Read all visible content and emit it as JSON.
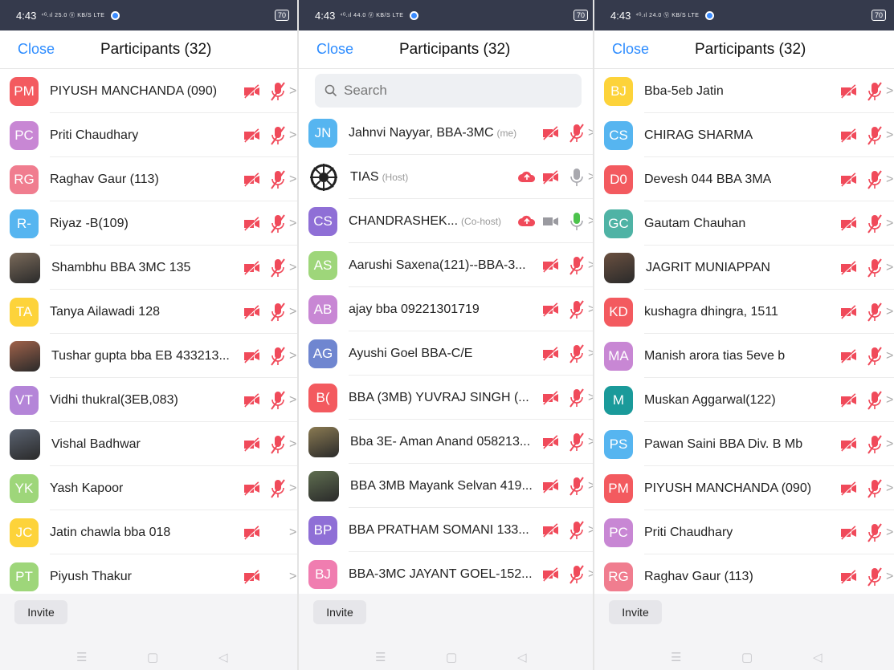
{
  "colors": {
    "accent": "#2d8cff",
    "muted_red": "#f04a5a",
    "statusbar": "#353a4c"
  },
  "panels": [
    {
      "status": {
        "time": "4:43",
        "signal": "⁴ᴳ.ıl 25.0 Ⓥ KB/S LTE",
        "battery": "70"
      },
      "header": {
        "close": "Close",
        "title": "Participants (32)"
      },
      "search": null,
      "participants": [
        {
          "initials": "PM",
          "color": "#f35a5f",
          "name": "PIYUSH MANCHANDA (090)",
          "video": "muted",
          "audio": "muted"
        },
        {
          "initials": "PC",
          "color": "#c887d4",
          "name": "Priti Chaudhary",
          "video": "muted",
          "audio": "muted"
        },
        {
          "initials": "RG",
          "color": "#f07d8f",
          "name": "Raghav Gaur (113)",
          "video": "muted",
          "audio": "muted"
        },
        {
          "initials": "R-",
          "color": "#56b5f0",
          "name": "Riyaz -B(109)",
          "video": "muted",
          "audio": "muted"
        },
        {
          "photo": "#7a6a5a",
          "name": "Shambhu BBA 3MC 135",
          "video": "muted",
          "audio": "muted"
        },
        {
          "initials": "TA",
          "color": "#fdd33a",
          "name": "Tanya Ailawadi 128",
          "video": "muted",
          "audio": "muted"
        },
        {
          "photo": "#a0624a",
          "name": "Tushar gupta bba EB 433213...",
          "video": "muted",
          "audio": "muted"
        },
        {
          "initials": "VT",
          "color": "#b485d8",
          "name": "Vidhi thukral(3EB,083)",
          "video": "muted",
          "audio": "muted"
        },
        {
          "photo": "#5a6270",
          "name": "Vishal Badhwar",
          "video": "muted",
          "audio": "muted"
        },
        {
          "initials": "YK",
          "color": "#9ed67a",
          "name": "Yash Kapoor",
          "video": "muted",
          "audio": "muted"
        },
        {
          "initials": "JC",
          "color": "#fdd33a",
          "name": "Jatin chawla bba 018",
          "video": "muted",
          "audio": "none"
        },
        {
          "initials": "PT",
          "color": "#9ed67a",
          "name": "Piyush Thakur",
          "video": "muted",
          "audio": "none"
        }
      ],
      "invite": "Invite"
    },
    {
      "status": {
        "time": "4:43",
        "signal": "⁴ᴳ.ıl 44.0 Ⓥ KB/S LTE",
        "battery": "70"
      },
      "header": {
        "close": "Close",
        "title": "Participants (32)"
      },
      "search": "Search",
      "participants": [
        {
          "initials": "JN",
          "color": "#56b5f0",
          "name": "Jahnvi Nayyar, BBA-3MC",
          "tag": "(me)",
          "video": "muted",
          "audio": "muted"
        },
        {
          "logo": true,
          "name": "TIAS",
          "tag": "(Host)",
          "cloud": true,
          "video": "muted",
          "audio": "off"
        },
        {
          "initials": "CS",
          "color": "#8f6fd6",
          "name": "CHANDRASHEK...",
          "tag": "(Co-host)",
          "cloud": true,
          "video": "grey",
          "audio": "on"
        },
        {
          "initials": "AS",
          "color": "#9ed67a",
          "name": "Aarushi Saxena(121)--BBA-3...",
          "video": "muted",
          "audio": "muted"
        },
        {
          "initials": "AB",
          "color": "#c887d4",
          "name": "ajay bba 09221301719",
          "video": "muted",
          "audio": "muted"
        },
        {
          "initials": "AG",
          "color": "#6f86d0",
          "name": "Ayushi Goel BBA-C/E",
          "video": "muted",
          "audio": "muted"
        },
        {
          "initials": "B(",
          "color": "#f35a5f",
          "name": "BBA (3MB) YUVRAJ SINGH  (...",
          "video": "muted",
          "audio": "muted"
        },
        {
          "photo": "#8a7a52",
          "name": "Bba 3E- Aman Anand 058213...",
          "video": "muted",
          "audio": "muted"
        },
        {
          "photo": "#5f6e50",
          "name": "BBA 3MB Mayank Selvan 419...",
          "video": "muted",
          "audio": "muted"
        },
        {
          "initials": "BP",
          "color": "#8f6fd6",
          "name": "BBA PRATHAM SOMANI 133...",
          "video": "muted",
          "audio": "muted"
        },
        {
          "initials": "BJ",
          "color": "#f07db0",
          "name": "BBA-3MC JAYANT GOEL-152...",
          "video": "muted",
          "audio": "muted"
        }
      ],
      "invite": "Invite"
    },
    {
      "status": {
        "time": "4:43",
        "signal": "⁴ᴳ.ıl 24.0 Ⓥ KB/S LTE",
        "battery": "70"
      },
      "header": {
        "close": "Close",
        "title": "Participants (32)"
      },
      "search": null,
      "participants": [
        {
          "initials": "BJ",
          "color": "#fdd33a",
          "name": "Bba-5eb Jatin",
          "video": "muted",
          "audio": "muted"
        },
        {
          "initials": "CS",
          "color": "#56b5f0",
          "name": "CHIRAG SHARMA",
          "video": "muted",
          "audio": "muted"
        },
        {
          "initials": "D0",
          "color": "#f35a5f",
          "name": "Devesh 044 BBA 3MA",
          "video": "muted",
          "audio": "muted"
        },
        {
          "initials": "GC",
          "color": "#4fb3a5",
          "name": "Gautam Chauhan",
          "video": "muted",
          "audio": "muted"
        },
        {
          "photo": "#6a5040",
          "name": "JAGRIT MUNIAPPAN",
          "video": "muted",
          "audio": "muted"
        },
        {
          "initials": "KD",
          "color": "#f35a5f",
          "name": "kushagra dhingra, 1511",
          "video": "muted",
          "audio": "muted"
        },
        {
          "initials": "MA",
          "color": "#c887d4",
          "name": "Manish arora  tias 5eve b",
          "video": "muted",
          "audio": "muted"
        },
        {
          "initials": "M",
          "color": "#1a9a9a",
          "name": "Muskan Aggarwal(122)",
          "video": "muted",
          "audio": "muted"
        },
        {
          "initials": "PS",
          "color": "#56b5f0",
          "name": "Pawan Saini BBA Div. B Mb",
          "video": "muted",
          "audio": "muted"
        },
        {
          "initials": "PM",
          "color": "#f35a5f",
          "name": "PIYUSH MANCHANDA (090)",
          "video": "muted",
          "audio": "muted"
        },
        {
          "initials": "PC",
          "color": "#c887d4",
          "name": "Priti Chaudhary",
          "video": "muted",
          "audio": "muted"
        },
        {
          "initials": "RG",
          "color": "#f07d8f",
          "name": "Raghav Gaur (113)",
          "video": "muted",
          "audio": "muted"
        }
      ],
      "invite": "Invite"
    }
  ]
}
